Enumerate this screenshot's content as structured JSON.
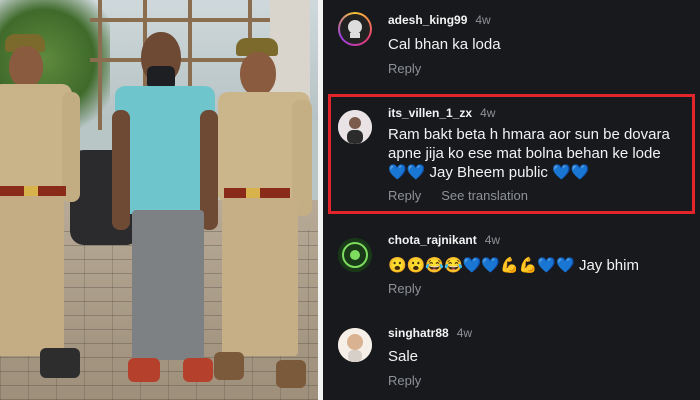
{
  "comments": [
    {
      "username": "adesh_king99",
      "time": "4w",
      "text": "Cal bhan ka loda",
      "reply": "Reply"
    },
    {
      "username": "its_villen_1_zx",
      "time": "4w",
      "line1": "Ram bakt beta h hmara aor sun be dovara",
      "line2": "apne jija ko ese mat bolna behan ke lode",
      "line3_emoji": "💙💙",
      "line3_text": "Jay Bheem public",
      "line3_emoji_end": "💙💙",
      "reply": "Reply",
      "translate": "See translation"
    },
    {
      "username": "chota_rajnikant",
      "time": "4w",
      "emoji": "😮😮😂😂💙💙💪💪💙💙",
      "text": "Jay bhim",
      "reply": "Reply"
    },
    {
      "username": "singhatr88",
      "time": "4w",
      "text": "Sale",
      "reply": "Reply"
    }
  ],
  "colors": {
    "panel_bg": "#17191d",
    "highlight_border": "#e2242b",
    "heart": "#3e87ef"
  }
}
